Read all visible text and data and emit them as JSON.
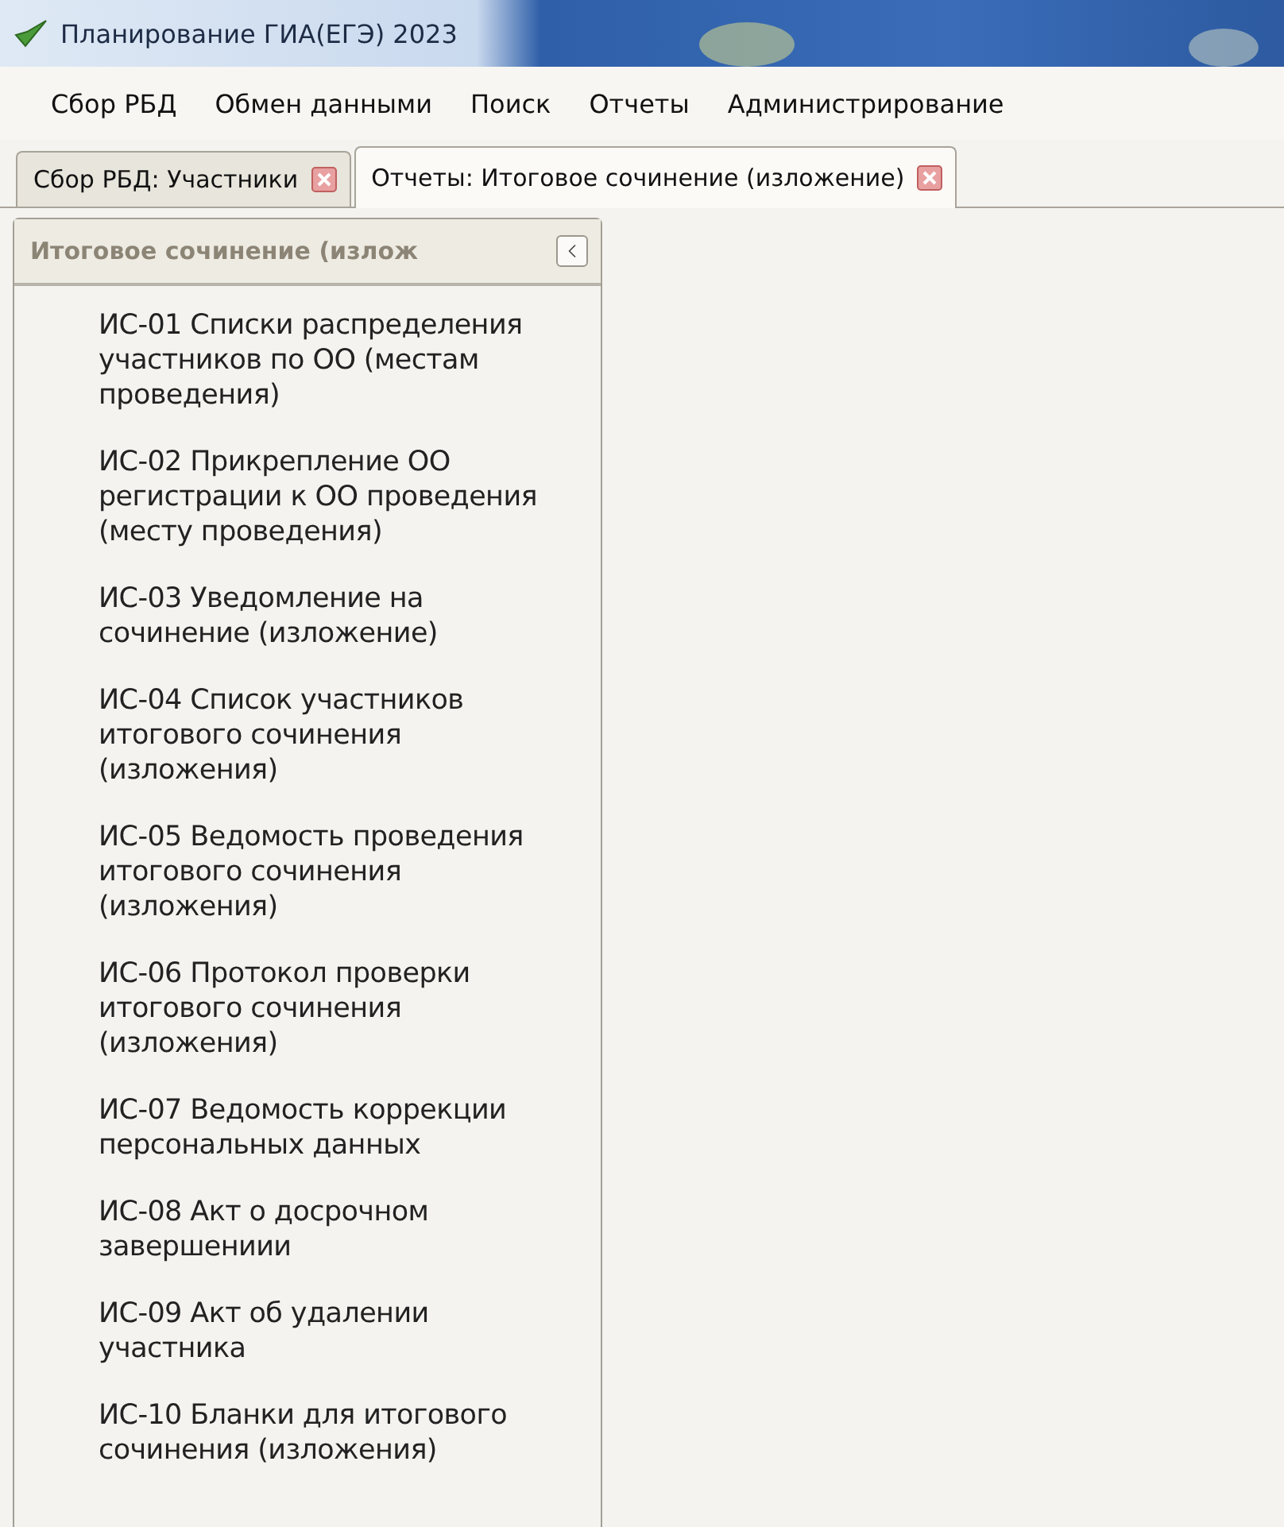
{
  "window": {
    "title": "Планирование ГИА(ЕГЭ) 2023"
  },
  "menu": [
    "Сбор РБД",
    "Обмен данными",
    "Поиск",
    "Отчеты",
    "Администрирование"
  ],
  "tabs": [
    {
      "label": "Сбор РБД: Участники",
      "selected": false
    },
    {
      "label": "Отчеты: Итоговое сочинение (изложение)",
      "selected": true
    }
  ],
  "panel": {
    "title": "Итоговое сочинение (излож",
    "items": [
      "ИС-01 Списки распределения участников по ОО (местам проведения)",
      "ИС-02 Прикрепление ОО регистрации к ОО проведения (месту проведения)",
      "ИС-03 Уведомление на сочинение (изложение)",
      "ИС-04 Список участников итогового сочинения (изложения)",
      "ИС-05 Ведомость проведения итогового сочинения (изложения)",
      "ИС-06 Протокол проверки итогового сочинения (изложения)",
      "ИС-07 Ведомость коррекции персональных данных",
      "ИС-08 Акт о досрочном завершениии",
      "ИС-09 Акт об удалении участника",
      "ИС-10 Бланки для итогового сочинения (изложения)"
    ]
  }
}
